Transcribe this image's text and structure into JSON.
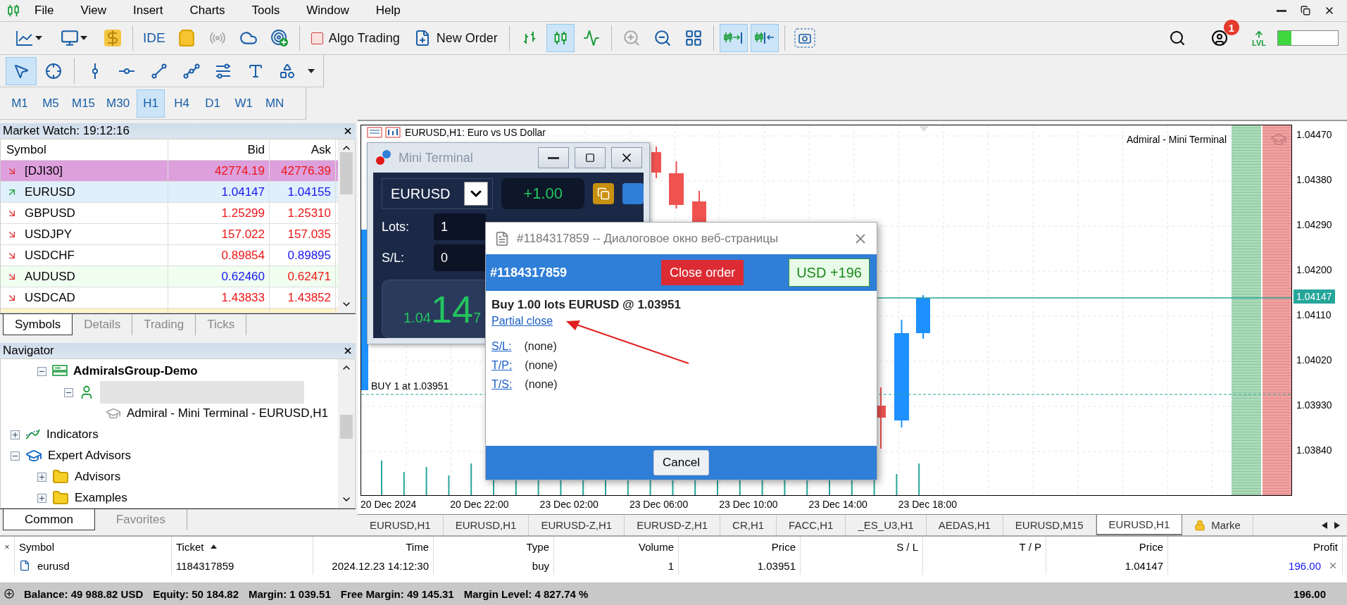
{
  "menu": [
    "File",
    "View",
    "Insert",
    "Charts",
    "Tools",
    "Window",
    "Help"
  ],
  "toolbar": {
    "signals_disabled": true,
    "ide": "IDE",
    "algo_trading": {
      "label": "Algo Trading",
      "on": false
    },
    "new_order": "New Order",
    "chart_types": [
      {
        "selected": false
      },
      {
        "selected": true
      },
      {
        "selected": false
      }
    ],
    "zoom_in_disabled": true,
    "autoscroll": {
      "selected": true
    },
    "chart_shift": {
      "selected": true
    },
    "notifications": "1",
    "level_label": "LVL",
    "level": 0.22
  },
  "drawing_tools": [
    {
      "selected": true
    },
    {
      "selected": false
    },
    {
      "selected": false
    },
    {
      "selected": false
    },
    {
      "selected": false
    },
    {
      "selected": false
    },
    {
      "selected": false
    },
    {
      "selected": false
    },
    {
      "selected": false
    }
  ],
  "timeframes": [
    {
      "label": "M1",
      "selected": false
    },
    {
      "label": "M5",
      "selected": false
    },
    {
      "label": "M15",
      "selected": false
    },
    {
      "label": "M30",
      "selected": false
    },
    {
      "label": "H1",
      "selected": true
    },
    {
      "label": "H4",
      "selected": false
    },
    {
      "label": "D1",
      "selected": false
    },
    {
      "label": "W1",
      "selected": false
    },
    {
      "label": "MN",
      "selected": false
    }
  ],
  "market_watch": {
    "title": "Market Watch: 19:12:16",
    "columns": [
      "Symbol",
      "Bid",
      "Ask"
    ],
    "rows": [
      {
        "symbol": "[DJI30]",
        "rising": false,
        "bid": "42774.19",
        "bid_rising": false,
        "ask": "42776.39",
        "ask_rising": false,
        "color": "#dda0dd"
      },
      {
        "symbol": "EURUSD",
        "rising": true,
        "bid": "1.04147",
        "bid_rising": true,
        "ask": "1.04155",
        "ask_rising": true,
        "color": "#e0effc"
      },
      {
        "symbol": "GBPUSD",
        "rising": false,
        "bid": "1.25299",
        "bid_rising": false,
        "ask": "1.25310",
        "ask_rising": false,
        "color": "#ffffff"
      },
      {
        "symbol": "USDJPY",
        "rising": false,
        "bid": "157.022",
        "bid_rising": false,
        "ask": "157.035",
        "ask_rising": false,
        "color": "#ffffff"
      },
      {
        "symbol": "USDCHF",
        "rising": false,
        "bid": "0.89854",
        "bid_rising": false,
        "ask": "0.89895",
        "ask_rising": true,
        "color": "#ffffff"
      },
      {
        "symbol": "AUDUSD",
        "rising": false,
        "bid": "0.62460",
        "bid_rising": true,
        "ask": "0.62471",
        "ask_rising": false,
        "color": "#f0fff0"
      },
      {
        "symbol": "USDCAD",
        "rising": false,
        "bid": "1.43833",
        "bid_rising": false,
        "ask": "1.43852",
        "ask_rising": false,
        "color": "#ffffff"
      },
      {
        "color": "#fdf3c8"
      }
    ],
    "tabs": [
      {
        "label": "Symbols",
        "selected": true
      },
      {
        "label": "Details",
        "selected": false
      },
      {
        "label": "Trading",
        "selected": false
      },
      {
        "label": "Ticks",
        "selected": false
      }
    ]
  },
  "navigator": {
    "title": "Navigator",
    "tree": [
      {
        "children": [
          {
            "kind": "server",
            "label": "AdmiralsGroup-Demo",
            "expanded": true,
            "children": [
              {
                "kind": "account",
                "redacted": true,
                "expanded": true,
                "children": [
                  {
                    "kind": "expert",
                    "label": "Admiral - Mini Terminal - EURUSD,H1"
                  }
                ]
              }
            ]
          }
        ]
      },
      {
        "kind": "indicators",
        "label": "Indicators",
        "expanded": false
      },
      {
        "kind": "experts",
        "label": "Expert Advisors",
        "expanded": true,
        "children": [
          {
            "kind": "folder",
            "label": "Advisors",
            "expanded": false
          },
          {
            "kind": "folder",
            "label": "Examples",
            "expanded": false
          }
        ]
      }
    ],
    "tabs": [
      {
        "label": "Common",
        "selected": true
      },
      {
        "label": "Favorites",
        "selected": false
      }
    ]
  },
  "chart": {
    "title": "EURUSD,H1: Euro vs US Dollar",
    "expert_label": "Admiral - Mini Terminal",
    "trade_label": "BUY 1 at 1.03951",
    "price_ticks": [
      "1.04470",
      "1.04380",
      "1.04290",
      "1.04200",
      "1.04110",
      "1.04020",
      "1.03930",
      "1.03840"
    ],
    "current_price": "1.04147",
    "time_ticks": [
      "20 Dec 2024",
      "20 Dec 22:00",
      "23 Dec 02:00",
      "23 Dec 06:00",
      "23 Dec 10:00",
      "23 Dec 14:00",
      "23 Dec 18:00"
    ]
  },
  "mini_terminal": {
    "title": "Mini Terminal",
    "symbol": "EURUSD",
    "volume": "+1.00",
    "fields": [
      {
        "label": "Lots:",
        "value": "1"
      },
      {
        "label": "S/L:",
        "value": "0"
      }
    ],
    "price": {
      "prefix": "1.04",
      "big": "14",
      "suffix": "7"
    }
  },
  "dialog": {
    "title": "#1184317859 -- Диалоговое окно веб-страницы",
    "ticket": "#1184317859",
    "close_button": "Close order",
    "profit": "USD +196",
    "summary": "Buy 1.00 lots EURUSD @ 1.03951",
    "link": "Partial close",
    "levels": [
      {
        "label": "S/L:",
        "value": "(none)"
      },
      {
        "label": "T/P:",
        "value": "(none)"
      },
      {
        "label": "T/S:",
        "value": "(none)"
      }
    ],
    "cancel": "Cancel"
  },
  "chart_tabs": [
    {
      "label": "EURUSD,H1",
      "selected": false,
      "locked": false
    },
    {
      "label": "EURUSD,H1",
      "selected": false,
      "locked": false
    },
    {
      "label": "EURUSD-Z,H1",
      "selected": false,
      "locked": false
    },
    {
      "label": "EURUSD-Z,H1",
      "selected": false,
      "locked": false
    },
    {
      "label": "CR,H1",
      "selected": false,
      "locked": false
    },
    {
      "label": "FACC,H1",
      "selected": false,
      "locked": false
    },
    {
      "label": "_ES_U3,H1",
      "selected": false,
      "locked": false
    },
    {
      "label": "AEDAS,H1",
      "selected": false,
      "locked": false
    },
    {
      "label": "EURUSD,M15",
      "selected": false,
      "locked": false
    },
    {
      "label": "EURUSD,H1",
      "selected": true,
      "locked": false
    },
    {
      "label": "Marke",
      "selected": false,
      "locked": true
    }
  ],
  "trade": {
    "columns": [
      {
        "label": "Symbol",
        "sorted": false
      },
      {
        "label": "Ticket",
        "sorted": true
      },
      {
        "label": "Time",
        "sorted": false
      },
      {
        "label": "Type",
        "sorted": false
      },
      {
        "label": "Volume",
        "sorted": false
      },
      {
        "label": "Price",
        "sorted": false
      },
      {
        "label": "S / L",
        "sorted": false
      },
      {
        "label": "T / P",
        "sorted": false
      },
      {
        "label": "Price",
        "sorted": false
      },
      {
        "label": "Profit",
        "sorted": false
      }
    ],
    "rows": [
      {
        "symbol": "eurusd",
        "ticket": "1184317859",
        "time": "2024.12.23 14:12:30",
        "type": "buy",
        "volume": "1",
        "price": "1.03951",
        "current_price": "1.04147",
        "profit": "196.00"
      }
    ],
    "summary": [
      "Balance: 49 988.82 USD",
      "Equity: 50 184.82",
      "Margin: 1 039.51",
      "Free Margin: 49 145.31",
      "Margin Level: 4 827.74 %"
    ],
    "total": "196.00"
  }
}
